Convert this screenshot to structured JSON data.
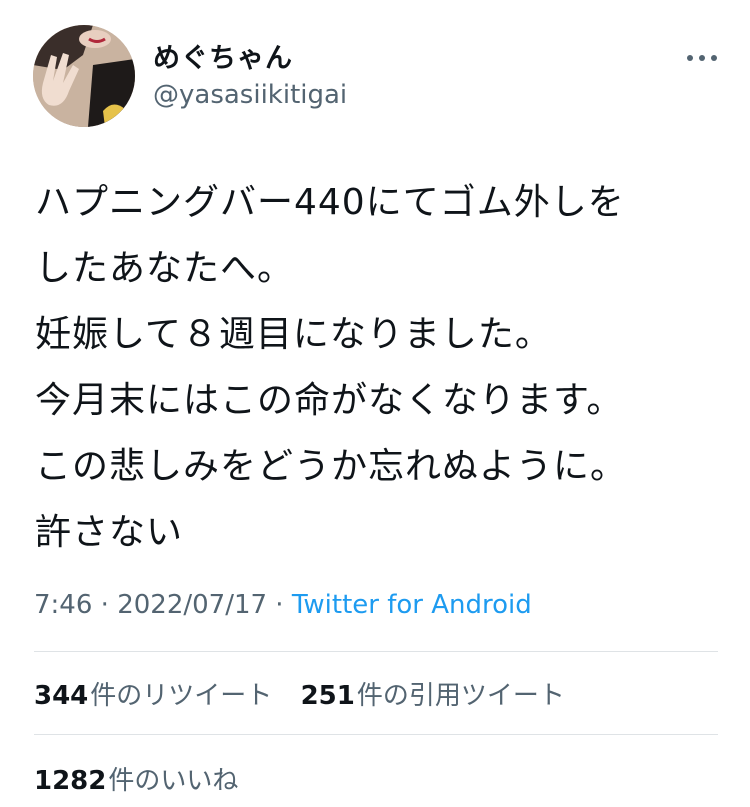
{
  "author": {
    "display_name": "めぐちゃん",
    "handle": "@yasasiikitigai"
  },
  "tweet": {
    "lines": [
      "ハプニングバー440にてゴム外しを",
      "したあなたへ。",
      "妊娠して８週目になりました。",
      "今月末にはこの命がなくなります。",
      "この悲しみをどうか忘れぬように。",
      "許さない"
    ],
    "time": "7:46",
    "separator": " · ",
    "date": "2022/07/17",
    "source": "Twitter for Android"
  },
  "stats": {
    "retweets": {
      "count": "344",
      "label": "件のリツイート"
    },
    "quotes": {
      "count": "251",
      "label": "件の引用ツイート"
    },
    "likes": {
      "count": "1282",
      "label": "件のいいね"
    }
  },
  "icons": {
    "more": "more-horizontal-icon"
  },
  "colors": {
    "text": "#0f1419",
    "secondary": "#536471",
    "link": "#1d9bf0",
    "divider": "#dfe3e6"
  }
}
